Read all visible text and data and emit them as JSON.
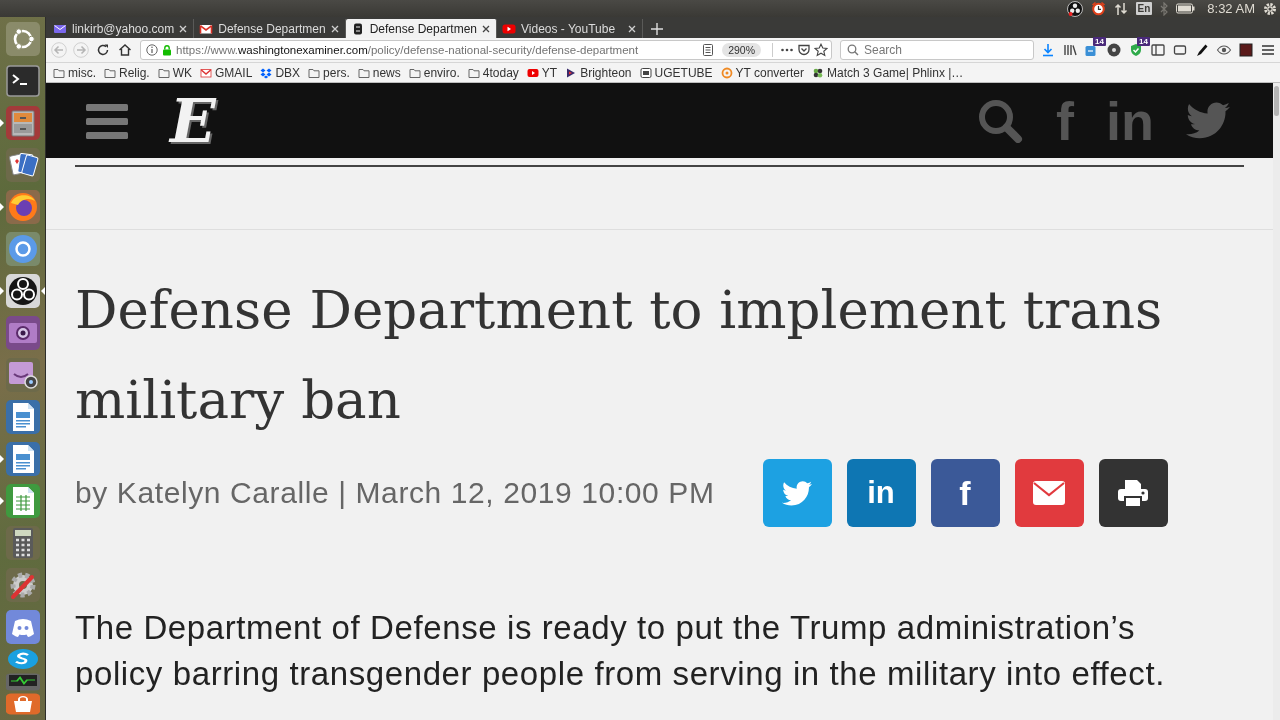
{
  "top_panel": {
    "keyboard_layout": "En",
    "bluetooth_on": false,
    "clock": "8:32 AM"
  },
  "launcher": [
    {
      "kind": "dash",
      "running": false,
      "focused": false
    },
    {
      "kind": "terminal",
      "running": false,
      "focused": false
    },
    {
      "kind": "files",
      "running": true,
      "focused": false
    },
    {
      "kind": "cards",
      "running": false,
      "focused": false
    },
    {
      "kind": "firefox",
      "running": true,
      "focused": false
    },
    {
      "kind": "chromium",
      "running": false,
      "focused": false
    },
    {
      "kind": "obs",
      "running": true,
      "focused": true
    },
    {
      "kind": "webcam",
      "running": false,
      "focused": false
    },
    {
      "kind": "cheese",
      "running": false,
      "focused": false
    },
    {
      "kind": "writer",
      "running": false,
      "focused": false
    },
    {
      "kind": "writer",
      "running": true,
      "focused": false
    },
    {
      "kind": "calc",
      "running": true,
      "focused": false
    },
    {
      "kind": "calculator",
      "running": false,
      "focused": false
    },
    {
      "kind": "settings",
      "running": false,
      "focused": false
    },
    {
      "kind": "discord",
      "running": false,
      "focused": false
    },
    {
      "kind": "skype",
      "running": false,
      "focused": false
    },
    {
      "kind": "monitor",
      "running": false,
      "focused": false
    },
    {
      "kind": "software",
      "running": false,
      "focused": false
    }
  ],
  "browser": {
    "tabs": [
      {
        "kind": "mail",
        "title": "linkirb@yahoo.com",
        "selected": false
      },
      {
        "kind": "gmail",
        "title": "Defense Departmen",
        "selected": false
      },
      {
        "kind": "examiner",
        "title": "Defense Departmen",
        "selected": true
      },
      {
        "kind": "youtube",
        "title": "Videos - YouTube",
        "selected": false
      }
    ],
    "toolbar": {
      "back_disabled": true,
      "forward_disabled": true,
      "url": {
        "prefix": "https://www.",
        "host": "washingtonexaminer.com",
        "path": "/policy/defense-national-security/defense-department"
      },
      "zoom": "290%",
      "search": {
        "placeholder": "Search"
      },
      "icons": [
        {
          "kind": "download"
        },
        {
          "kind": "library"
        },
        {
          "kind": "extension",
          "badge": "14"
        },
        {
          "kind": "disc"
        },
        {
          "kind": "shield",
          "badge": "14"
        },
        {
          "kind": "sidebar"
        },
        {
          "kind": "window"
        },
        {
          "kind": "brush"
        },
        {
          "kind": "eye"
        },
        {
          "kind": "square"
        }
      ]
    },
    "bookmarks": [
      {
        "kind": "folder",
        "label": "misc."
      },
      {
        "kind": "folder",
        "label": "Relig."
      },
      {
        "kind": "folder",
        "label": "WK"
      },
      {
        "kind": "gmail",
        "label": "GMAIL"
      },
      {
        "kind": "dropbox",
        "label": "DBX"
      },
      {
        "kind": "folder",
        "label": "pers."
      },
      {
        "kind": "folder",
        "label": "news"
      },
      {
        "kind": "folder",
        "label": "enviro."
      },
      {
        "kind": "folder",
        "label": "4today"
      },
      {
        "kind": "youtube",
        "label": "YT"
      },
      {
        "kind": "brighteon",
        "label": "Brighteon"
      },
      {
        "kind": "ugetube",
        "label": "UGETUBE"
      },
      {
        "kind": "converter",
        "label": "YT converter"
      },
      {
        "kind": "game",
        "label": "Match 3 Game| Phlinx |…"
      }
    ]
  },
  "page": {
    "site_header": {
      "logo": "E",
      "facebook_glyph": "f",
      "linkedin_glyph": "in"
    },
    "article": {
      "headline": "Defense Department to implement trans military ban",
      "byline": "by Katelyn Caralle | March 12, 2019 10:00 PM",
      "share_buttons": [
        {
          "kind": "twitter",
          "color": "#1da1e2"
        },
        {
          "kind": "linkedin",
          "glyph": "in",
          "color": "#0e76b3"
        },
        {
          "kind": "facebook",
          "glyph": "f",
          "color": "#3b5998"
        },
        {
          "kind": "email",
          "color": "#e13a3e"
        },
        {
          "kind": "print",
          "color": "#333333"
        }
      ],
      "body": "The Department of Defense is ready to put the Trump administration’s policy barring transgender people from serving in the military into effect."
    }
  }
}
